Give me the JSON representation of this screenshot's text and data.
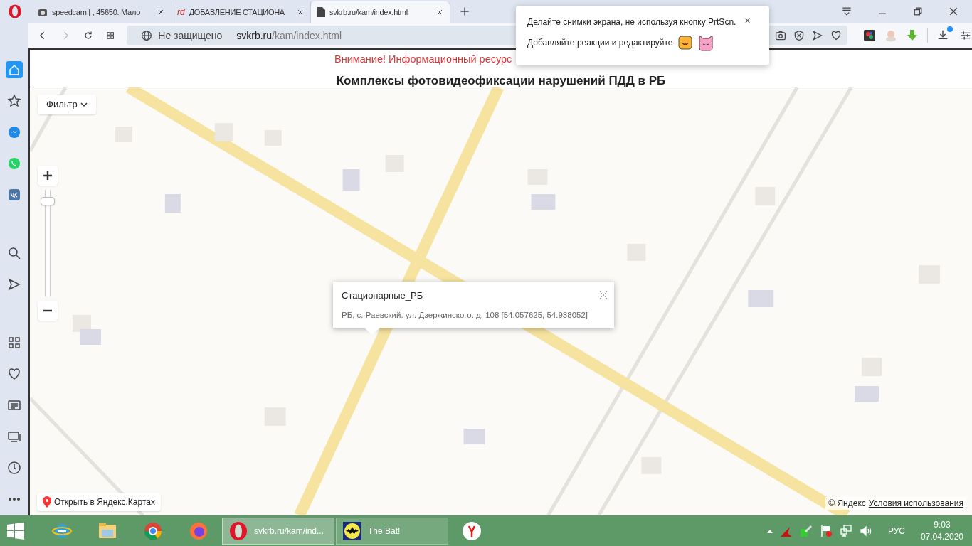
{
  "browser": {
    "tabs": [
      {
        "title": "speedcam | , 45650. Мало",
        "kind": "camera",
        "selected": false
      },
      {
        "title": "ДОБАВЛЕНИЕ СТАЦИОНА",
        "kind": "logo",
        "logo": "rd",
        "selected": false
      },
      {
        "title": "svkrb.ru/kam/index.html",
        "kind": "page",
        "selected": true
      }
    ],
    "address": {
      "security": "Не защищено",
      "host": "svkrb.ru",
      "path": "/kam/index.html"
    },
    "sidebar": [
      {
        "kind": "home",
        "selected": true
      },
      {
        "kind": "star",
        "selected": false
      },
      {
        "kind": "messenger",
        "selected": false
      },
      {
        "kind": "whatsapp",
        "selected": false
      },
      {
        "kind": "vk",
        "selected": false
      },
      {
        "kind": "search",
        "selected": false
      },
      {
        "kind": "send",
        "selected": false
      },
      {
        "kind": "grid",
        "selected": false
      },
      {
        "kind": "heart",
        "selected": false
      },
      {
        "kind": "news",
        "selected": false
      },
      {
        "kind": "display",
        "selected": false
      },
      {
        "kind": "clock",
        "selected": false
      },
      {
        "kind": "more",
        "selected": false
      }
    ]
  },
  "notification": {
    "lines": [
      "Делайте снимки экрана, не используя кнопку PrtScn.",
      "Добавляйте реакции и редактируйте"
    ],
    "close": "×"
  },
  "page": {
    "notice": "Внимание! Информационный ресурс",
    "title": "Комплексы фотовидеофиксации нарушений ПДД в РБ"
  },
  "map": {
    "filter": "Фильтр",
    "zoom": {
      "level": 0.93
    },
    "balloon": {
      "title": "Стационарные_РБ",
      "text": "РБ, с. Раевский. ул. Дзержинского. д. 108 [54.057625, 54.938052]"
    },
    "open_link": "Открыть в Яндекс.Картах",
    "copyright": "© Яндекс",
    "terms": "Условия использования"
  },
  "taskbar": {
    "items": [
      {
        "kind": "ie",
        "selected": false
      },
      {
        "kind": "explorer",
        "selected": false
      },
      {
        "kind": "chrome",
        "selected": false
      },
      {
        "kind": "firefox",
        "selected": false
      },
      {
        "kind": "opera",
        "label": "svkrb.ru/kam/ind...",
        "selected": true
      },
      {
        "kind": "bat",
        "label": "The Bat!",
        "selected": false
      },
      {
        "kind": "yandex",
        "selected": false
      }
    ],
    "language": "РУС",
    "time": "9:03",
    "date": "07.04.2020"
  }
}
